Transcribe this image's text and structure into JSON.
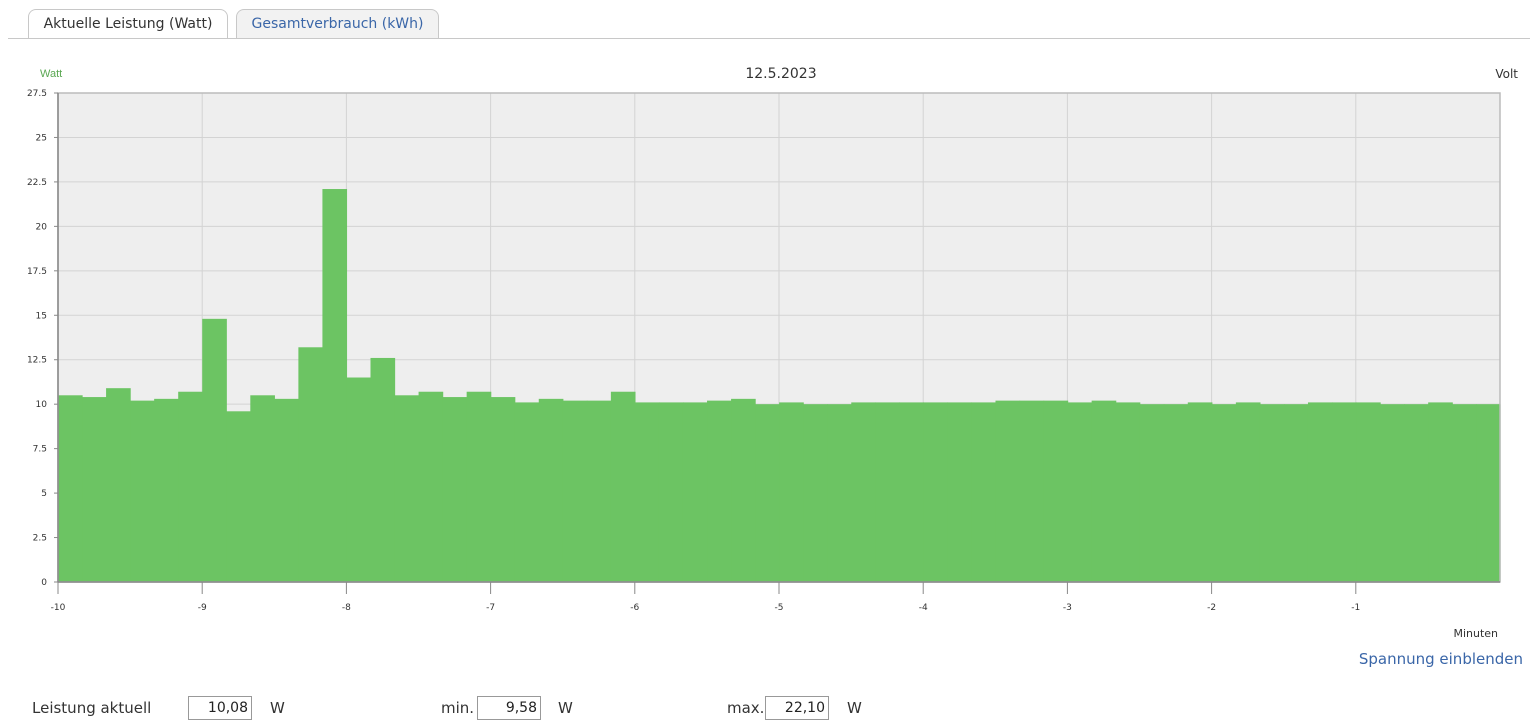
{
  "tabs": [
    {
      "label": "Aktuelle Leistung (Watt)",
      "active": true
    },
    {
      "label": "Gesamtverbrauch (kWh)",
      "active": false
    }
  ],
  "colors": {
    "bar": "#6cc463",
    "plot_bg": "#eeeeee",
    "grid": "#d3d3d3",
    "axis": "#888888",
    "link": "#3a66a8",
    "y_label": "#5aa752"
  },
  "chart_data": {
    "type": "bar",
    "title": "12.5.2023",
    "ylabel_left": "Watt",
    "ylabel_right": "Volt",
    "xlabel": "Minuten",
    "ylim": [
      0,
      27.5
    ],
    "yticks": [
      "0",
      "2.5",
      "5",
      "7.5",
      "10",
      "12.5",
      "15",
      "17.5",
      "20",
      "22.5",
      "25",
      "27.5"
    ],
    "xlim": [
      -10,
      0
    ],
    "xticks": [
      "-10",
      "-9",
      "-8",
      "-7",
      "-6",
      "-5",
      "-4",
      "-3",
      "-2",
      "-1"
    ],
    "bar_width_min": 0.1667,
    "values": [
      10.5,
      10.4,
      10.9,
      10.2,
      10.3,
      10.7,
      14.8,
      9.6,
      10.5,
      10.3,
      13.2,
      22.1,
      11.5,
      12.6,
      10.5,
      10.7,
      10.4,
      10.7,
      10.4,
      10.1,
      10.3,
      10.2,
      10.2,
      10.7,
      10.1,
      10.1,
      10.1,
      10.2,
      10.3,
      10.0,
      10.1,
      10.0,
      10.0,
      10.1,
      10.1,
      10.1,
      10.1,
      10.1,
      10.1,
      10.2,
      10.2,
      10.2,
      10.1,
      10.2,
      10.1,
      10.0,
      10.0,
      10.1,
      10.0,
      10.1,
      10.0,
      10.0,
      10.1,
      10.1,
      10.1,
      10.0,
      10.0,
      10.1,
      10.0,
      10.0
    ]
  },
  "toggle_voltage_label": "Spannung einblenden",
  "stats": {
    "current_label": "Leistung aktuell",
    "current_value": "10,08",
    "current_unit": "W",
    "min_label": "min.",
    "min_value": "9,58",
    "min_unit": "W",
    "max_label": "max.",
    "max_value": "22,10",
    "max_unit": "W"
  }
}
